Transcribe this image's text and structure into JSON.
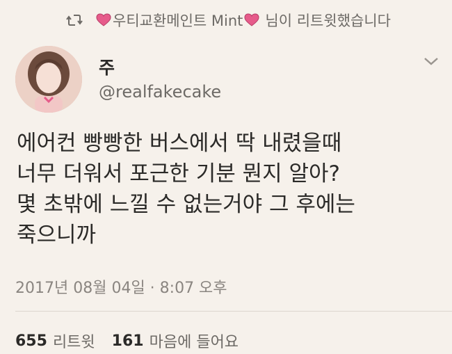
{
  "retweet": {
    "name_prefix": "우티교환메인트 Mint",
    "suffix": "님이 리트윗했습니다"
  },
  "author": {
    "name": "주",
    "handle": "@realfakecake"
  },
  "tweet": {
    "lines": [
      "에어컨 빵빵한 버스에서 딱 내렸을때",
      "너무 더워서 포근한 기분 뭔지 알아?",
      "몇 초밖에 느낄 수 없는거야 그 후에는",
      "죽으니까"
    ]
  },
  "timestamp": "2017년 08월 04일 · 8:07 오후",
  "stats": {
    "retweets_count": "655",
    "retweets_label": "리트윗",
    "likes_count": "161",
    "likes_label": "마음에 들어요"
  },
  "colors": {
    "background": "#f6f1eb",
    "heart": "#e65b8a",
    "text_primary": "#2b2a28",
    "text_secondary": "#6d6a66"
  },
  "icons": {
    "retweet": "retweet-icon",
    "heart": "heart-icon",
    "caret": "chevron-down-icon"
  }
}
